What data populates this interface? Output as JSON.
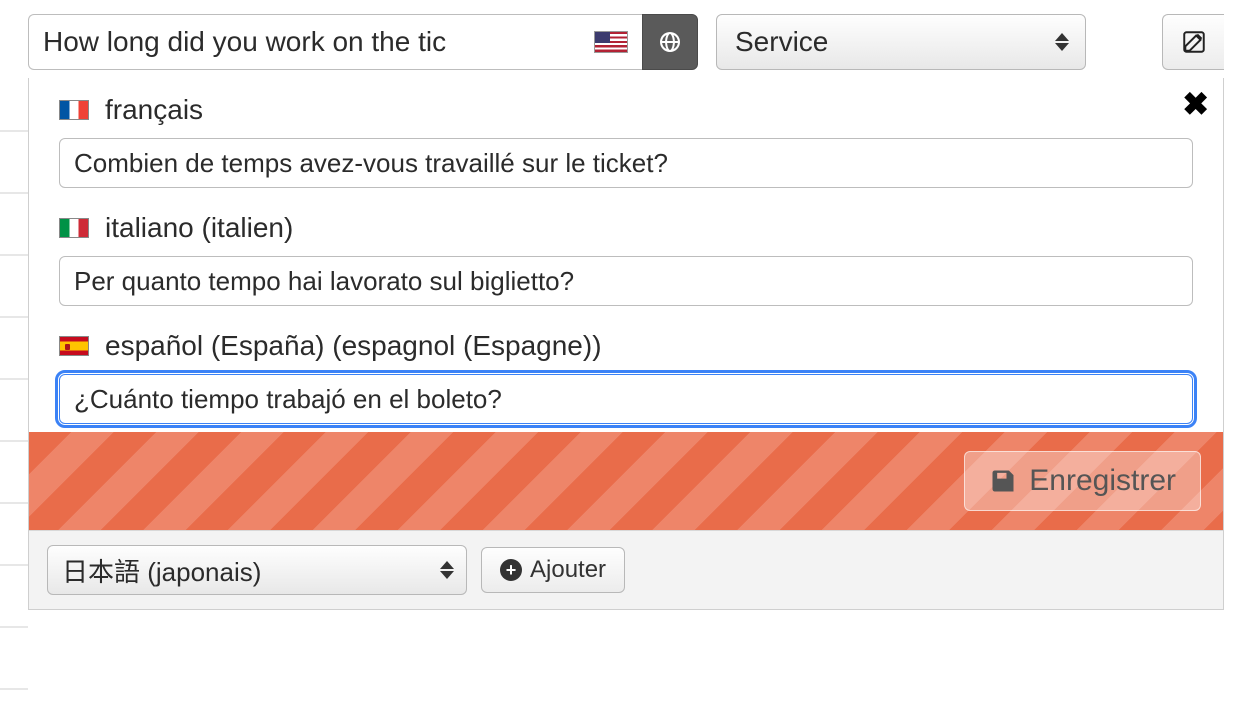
{
  "main_input": {
    "value": "How long did you work on the tic",
    "flag": "us"
  },
  "service_select": {
    "value": "Service"
  },
  "close_label": "✕",
  "translations": [
    {
      "flag": "fr",
      "label": "français",
      "value": "Combien de temps avez-vous travaillé sur le ticket?",
      "focused": false
    },
    {
      "flag": "it",
      "label": "italiano (italien)",
      "value": "Per quanto tempo hai lavorato sul biglietto?",
      "focused": false
    },
    {
      "flag": "es",
      "label": "español (España) (espagnol (Espagne))",
      "value": "¿Cuánto tiempo trabajó en el boleto?",
      "focused": true
    }
  ],
  "save_label": "Enregistrer",
  "add_language_select": {
    "value": "日本語 (japonais)"
  },
  "add_button_label": "Ajouter"
}
